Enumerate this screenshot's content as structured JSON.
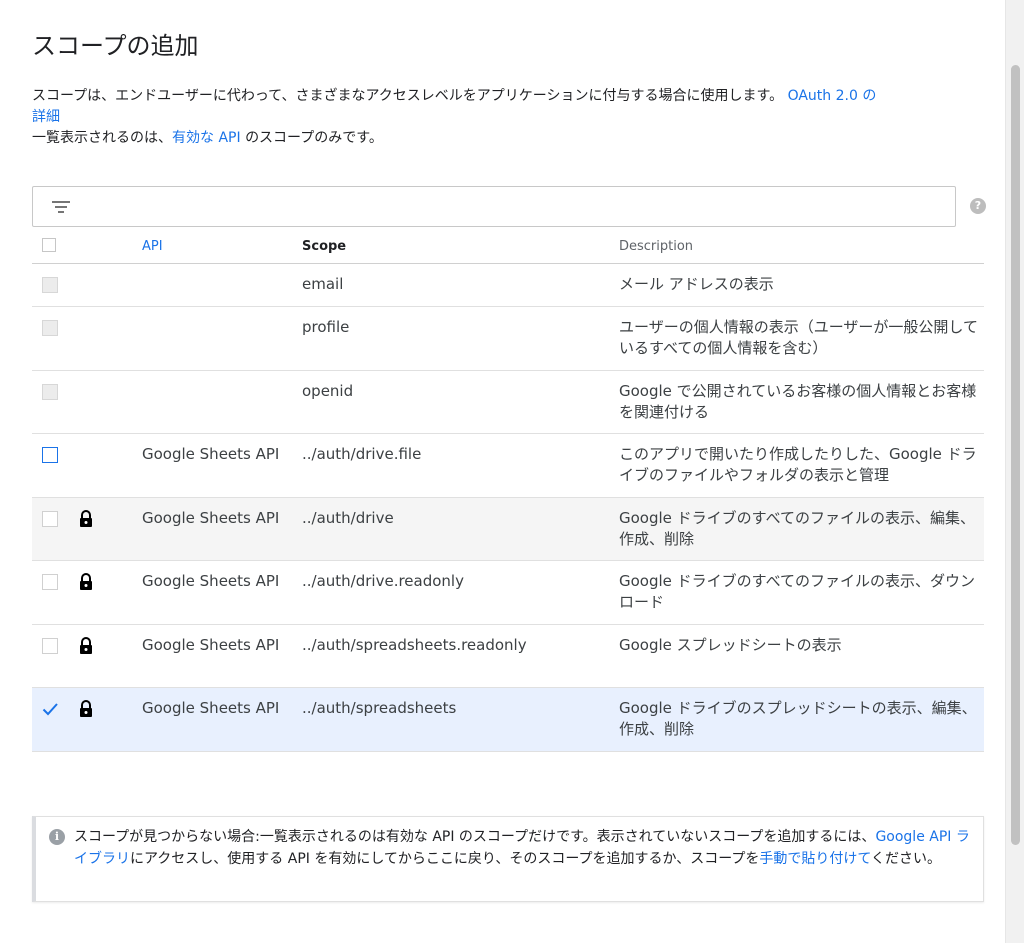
{
  "dialog": {
    "title": "スコープの追加",
    "description_main": "スコープは、エンドユーザーに代わって、さまざまなアクセスレベルをアプリケーションに付与する場合に使用します。",
    "oauth_link_a": "OAuth 2.0 の",
    "oauth_link_b": "詳細",
    "note_prefix": "一覧表示されるのは、",
    "note_link": "有効な API",
    "note_suffix": "のスコープのみです。"
  },
  "filter": {
    "icon": "filter-icon",
    "placeholder": "",
    "help_icon": "help-icon"
  },
  "table": {
    "headers": {
      "api": "API",
      "scope": "Scope",
      "description": "Description"
    },
    "rows": [
      {
        "state": "disabled",
        "locked": false,
        "api": "",
        "scope": "email",
        "description": "メール アドレスの表示"
      },
      {
        "state": "disabled",
        "locked": false,
        "api": "",
        "scope": "profile",
        "description": "ユーザーの個人情報の表示（ユーザーが一般公開しているすべての個人情報を含む）"
      },
      {
        "state": "disabled",
        "locked": false,
        "api": "",
        "scope": "openid",
        "description": "Google で公開されているお客様の個人情報とお客様を関連付ける"
      },
      {
        "state": "unchecked-active",
        "locked": false,
        "api": "Google Sheets API",
        "scope": "../auth/drive.file",
        "description": "このアプリで開いたり作成したりした、Google ドライブのファイルやフォルダの表示と管理"
      },
      {
        "state": "unchecked",
        "locked": true,
        "api": "Google Sheets API",
        "scope": "../auth/drive",
        "description": "Google ドライブのすべてのファイルの表示、編集、作成、削除"
      },
      {
        "state": "unchecked",
        "locked": true,
        "api": "Google Sheets API",
        "scope": "../auth/drive.readonly",
        "description": "Google ドライブのすべてのファイルの表示、ダウンロード"
      },
      {
        "state": "unchecked",
        "locked": true,
        "api": "Google Sheets API",
        "scope": "../auth/spreadsheets.readonly",
        "description": "Google スプレッドシートの表示"
      },
      {
        "state": "checked",
        "locked": true,
        "api": "Google Sheets API",
        "scope": "../auth/spreadsheets",
        "description": "Google ドライブのスプレッドシートの表示、編集、作成、削除"
      }
    ]
  },
  "notice": {
    "text1": "スコープが見つからない場合:一覧表示されるのは有効な API のスコープだけです。表示されていないスコープを追加するには、",
    "link1": "Google API ライブラリ",
    "text2": "にアクセスし、使用する API を有効にしてからここに戻り、そのスコープを追加するか、スコープを",
    "link2": "手動で貼り付けて",
    "text3": "ください。"
  },
  "colors": {
    "link": "#1a73e8",
    "selected_row": "#e8f0fe",
    "hover_row": "#f5f5f5"
  }
}
